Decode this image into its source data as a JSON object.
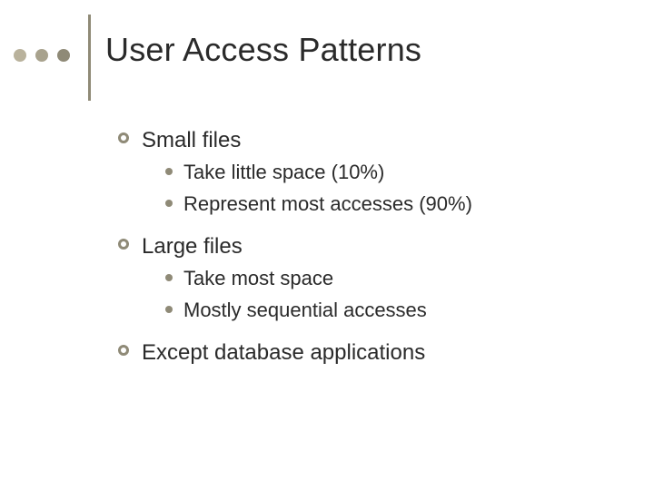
{
  "title": "User Access Patterns",
  "items": [
    {
      "label": "Small files",
      "sub": [
        "Take little space (10%)",
        "Represent most accesses (90%)"
      ]
    },
    {
      "label": "Large files",
      "sub": [
        "Take most space",
        "Mostly sequential accesses"
      ]
    },
    {
      "label": "Except database applications",
      "sub": []
    }
  ]
}
